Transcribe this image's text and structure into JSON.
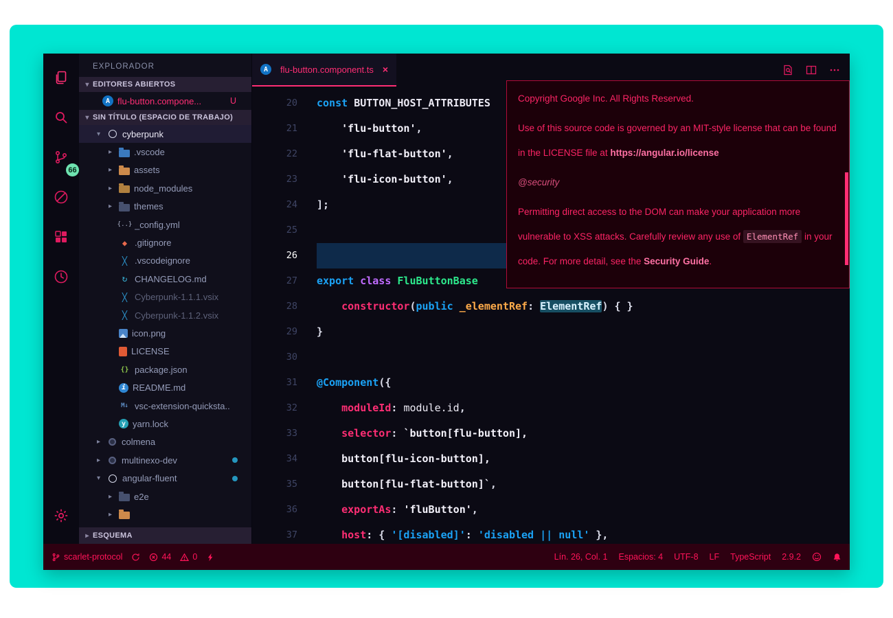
{
  "colors": {
    "desktop_cyan": "#00e6d2",
    "accent_pink": "#ff2e74",
    "icon_pink": "#df1a5f",
    "status_red": "#ff1459",
    "badge_green": "#6fe3b0",
    "editor_bg": "#0b0a14",
    "current_line_bg": "#0e2a4a",
    "tooltip_bg": "#1c0009"
  },
  "activity_bar": {
    "badge": "66",
    "items": [
      {
        "name": "explorer",
        "active": true
      },
      {
        "name": "search"
      },
      {
        "name": "source-control",
        "badge": "66"
      },
      {
        "name": "debug"
      },
      {
        "name": "extensions"
      },
      {
        "name": "history"
      }
    ],
    "bottom_items": [
      {
        "name": "settings"
      }
    ]
  },
  "sidebar": {
    "title": "EXPLORADOR",
    "open_editors": {
      "header": "EDITORES ABIERTOS",
      "items": [
        {
          "label": "flu-button.compone...",
          "badge": "U",
          "icon": "angular"
        }
      ]
    },
    "workspace_header": "SIN TÍTULO (ESPACIO DE TRABAJO)",
    "outline_header": "ESQUEMA",
    "tree": [
      {
        "indent": 0,
        "arrow": "down",
        "icon": "circle-outline",
        "label": "cyberpunk",
        "selected": true
      },
      {
        "indent": 1,
        "arrow": "right",
        "icon": "folder-vscode",
        "label": ".vscode"
      },
      {
        "indent": 1,
        "arrow": "right",
        "icon": "folder-assets",
        "label": "assets"
      },
      {
        "indent": 1,
        "arrow": "right",
        "icon": "folder-node",
        "label": "node_modules"
      },
      {
        "indent": 1,
        "arrow": "right",
        "icon": "folder-dark",
        "label": "themes"
      },
      {
        "indent": 1,
        "icon": "yml",
        "label": "_config.yml"
      },
      {
        "indent": 1,
        "icon": "git",
        "label": ".gitignore"
      },
      {
        "indent": 1,
        "icon": "vscode-logo",
        "label": ".vscodeignore"
      },
      {
        "indent": 1,
        "icon": "changelog",
        "label": "CHANGELOG.md"
      },
      {
        "indent": 1,
        "icon": "vsix",
        "label": "Cyberpunk-1.1.1.vsix",
        "dim": true
      },
      {
        "indent": 1,
        "icon": "vsix",
        "label": "Cyberpunk-1.1.2.vsix",
        "dim": true
      },
      {
        "indent": 1,
        "icon": "image",
        "label": "icon.png"
      },
      {
        "indent": 1,
        "icon": "license",
        "label": "LICENSE"
      },
      {
        "indent": 1,
        "icon": "json",
        "label": "package.json"
      },
      {
        "indent": 1,
        "icon": "info",
        "label": "README.md"
      },
      {
        "indent": 1,
        "icon": "markdown",
        "label": "vsc-extension-quicksta.."
      },
      {
        "indent": 1,
        "icon": "yarn",
        "label": "yarn.lock"
      },
      {
        "indent": 0,
        "arrow": "right",
        "icon": "circle-filled",
        "label": "colmena"
      },
      {
        "indent": 0,
        "arrow": "right",
        "icon": "circle-filled",
        "label": "multinexo-dev",
        "dot": true
      },
      {
        "indent": 0,
        "arrow": "down",
        "icon": "circle-outline",
        "label": "angular-fluent",
        "dot": true
      },
      {
        "indent": 1,
        "arrow": "right",
        "icon": "folder-dark",
        "label": "e2e"
      },
      {
        "indent": 1,
        "arrow": "right",
        "icon": "folder-orange",
        "label": ""
      }
    ]
  },
  "editor": {
    "tabs": [
      {
        "label": "flu-button.component.ts",
        "icon": "angular",
        "modified": true,
        "active": true
      }
    ],
    "actions": [
      "open-changes",
      "split-editor",
      "more-actions"
    ],
    "current_line": 26,
    "lines": [
      {
        "n": 20,
        "tokens": [
          [
            "kw",
            "const "
          ],
          [
            "ident",
            "BUTTON_HOST_ATTRIBUTES"
          ]
        ]
      },
      {
        "n": 21,
        "tokens": [
          [
            "punct",
            "    "
          ],
          [
            "str",
            "'flu-button'"
          ],
          [
            "punct",
            ","
          ]
        ]
      },
      {
        "n": 22,
        "tokens": [
          [
            "punct",
            "    "
          ],
          [
            "str",
            "'flu-flat-button'"
          ],
          [
            "punct",
            ","
          ]
        ]
      },
      {
        "n": 23,
        "tokens": [
          [
            "punct",
            "    "
          ],
          [
            "str",
            "'flu-icon-button'"
          ],
          [
            "punct",
            ","
          ]
        ]
      },
      {
        "n": 24,
        "tokens": [
          [
            "punct",
            "];"
          ]
        ]
      },
      {
        "n": 25,
        "tokens": []
      },
      {
        "n": 26,
        "tokens": []
      },
      {
        "n": 27,
        "tokens": [
          [
            "kw",
            "export "
          ],
          [
            "kw2",
            "class "
          ],
          [
            "cls",
            "FluButtonBase"
          ]
        ]
      },
      {
        "n": 28,
        "tokens": [
          [
            "punct",
            "    "
          ],
          [
            "kw3",
            "constructor"
          ],
          [
            "punct",
            "("
          ],
          [
            "kw",
            "public "
          ],
          [
            "var",
            "_elementRef"
          ],
          [
            "punct",
            ": "
          ],
          [
            "clshl",
            "ElementRef"
          ],
          [
            "punct",
            ") { }"
          ]
        ]
      },
      {
        "n": 29,
        "tokens": [
          [
            "punct",
            "}"
          ]
        ]
      },
      {
        "n": 30,
        "tokens": []
      },
      {
        "n": 31,
        "tokens": [
          [
            "deco",
            "@Component"
          ],
          [
            "punct",
            "({"
          ]
        ]
      },
      {
        "n": 32,
        "tokens": [
          [
            "punct",
            "    "
          ],
          [
            "prop",
            "moduleId"
          ],
          [
            "punct",
            ": "
          ],
          [
            "ident2",
            "module.id"
          ],
          [
            "punct",
            ","
          ]
        ]
      },
      {
        "n": 33,
        "tokens": [
          [
            "punct",
            "    "
          ],
          [
            "prop",
            "selector"
          ],
          [
            "punct",
            ": "
          ],
          [
            "str",
            "`button[flu-button],"
          ]
        ]
      },
      {
        "n": 34,
        "tokens": [
          [
            "punct",
            "    "
          ],
          [
            "str",
            "button[flu-icon-button],"
          ]
        ]
      },
      {
        "n": 35,
        "tokens": [
          [
            "punct",
            "    "
          ],
          [
            "str",
            "button[flu-flat-button]`"
          ],
          [
            "punct",
            ","
          ]
        ]
      },
      {
        "n": 36,
        "tokens": [
          [
            "punct",
            "    "
          ],
          [
            "prop",
            "exportAs"
          ],
          [
            "punct",
            ": "
          ],
          [
            "str",
            "'fluButton'"
          ],
          [
            "punct",
            ","
          ]
        ]
      },
      {
        "n": 37,
        "tokens": [
          [
            "punct",
            "    "
          ],
          [
            "prop",
            "host"
          ],
          [
            "punct",
            ": { "
          ],
          [
            "str3",
            "'[disabled]'"
          ],
          [
            "punct",
            ": "
          ],
          [
            "str3",
            "'disabled || null'"
          ],
          [
            "punct",
            " },"
          ]
        ]
      }
    ]
  },
  "hover_tooltip": {
    "paragraphs": [
      [
        [
          "t",
          "Copyright Google Inc. All Rights Reserved."
        ]
      ],
      [
        [
          "t",
          "Use of this source code is governed by an MIT-style license that can be found in the LICENSE file at "
        ],
        [
          "link",
          "https://angular.io/license"
        ]
      ],
      [
        [
          "italic",
          "@security"
        ]
      ],
      [
        [
          "t",
          "Permitting direct access to the DOM can make your application more vulnerable to XSS attacks. Carefully review any use of "
        ],
        [
          "code",
          "ElementRef"
        ],
        [
          "t",
          " in your code. For more detail, see the "
        ],
        [
          "link",
          "Security Guide"
        ],
        [
          "t",
          "."
        ]
      ]
    ]
  },
  "status_bar": {
    "left": [
      {
        "name": "git-branch",
        "icon": "git-branch",
        "label": "scarlet-protocol"
      },
      {
        "name": "sync",
        "icon": "sync",
        "label": ""
      },
      {
        "name": "errors",
        "icon": "error",
        "label": "44"
      },
      {
        "name": "warnings",
        "icon": "warning",
        "label": "0"
      },
      {
        "name": "format-power",
        "icon": "lightning",
        "label": ""
      }
    ],
    "right": [
      {
        "name": "cursor-position",
        "label": "Lín. 26, Col. 1"
      },
      {
        "name": "indentation",
        "label": "Espacios: 4"
      },
      {
        "name": "encoding",
        "label": "UTF-8"
      },
      {
        "name": "eol",
        "label": "LF"
      },
      {
        "name": "language",
        "label": "TypeScript"
      },
      {
        "name": "version",
        "label": "2.9.2"
      },
      {
        "name": "feedback",
        "icon": "smiley",
        "label": ""
      },
      {
        "name": "notifications",
        "icon": "bell",
        "label": ""
      }
    ]
  }
}
